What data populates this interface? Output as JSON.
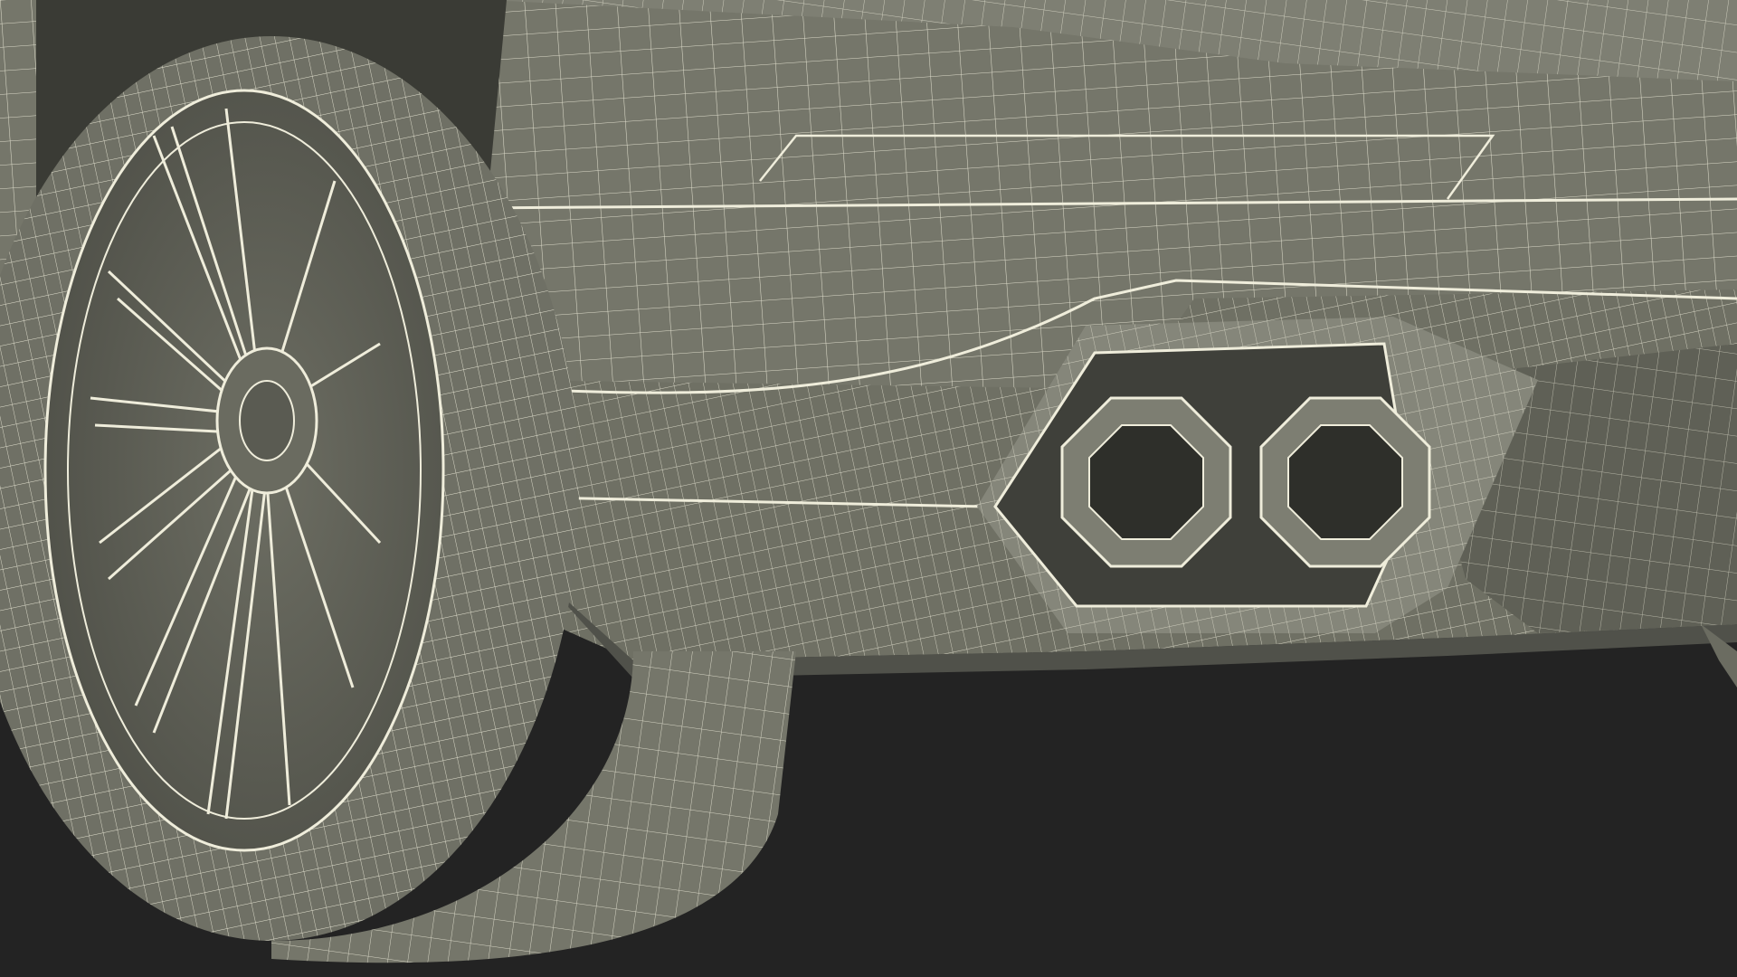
{
  "scene": {
    "subject": "car-rear-wheel-and-exhaust-wireframe",
    "colors": {
      "background": "#232323",
      "surface": "#75766a",
      "surface_dark": "#5e5f55",
      "surface_light": "#85867a",
      "shadow": "#3f403a",
      "wire": "#f2f0dc",
      "tire": "#6f7065",
      "cavity": "#2e2f2a"
    }
  }
}
